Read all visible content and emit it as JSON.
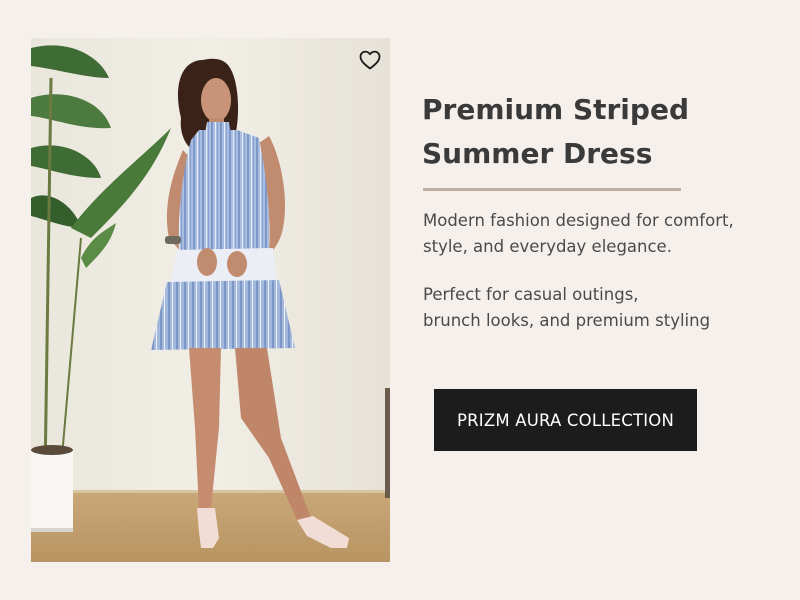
{
  "product": {
    "title": "Premium Striped\nSummer Dress",
    "description": "Modern fashion designed for comfort,\nstyle, and everyday elegance.",
    "tagline": "Perfect for casual outings,\nbrunch looks, and premium styling"
  },
  "cta": {
    "label": "PRIZM AURA COLLECTION"
  },
  "icons": {
    "wishlist": "heart-outline-icon"
  },
  "colors": {
    "background": "#f5f0ec",
    "title": "#3a3a3a",
    "body_text": "#4a4a4a",
    "divider": "#bfb0a0",
    "button_bg": "#1c1c1c",
    "button_text": "#ffffff",
    "dress_blue": "#9fb6dc"
  }
}
